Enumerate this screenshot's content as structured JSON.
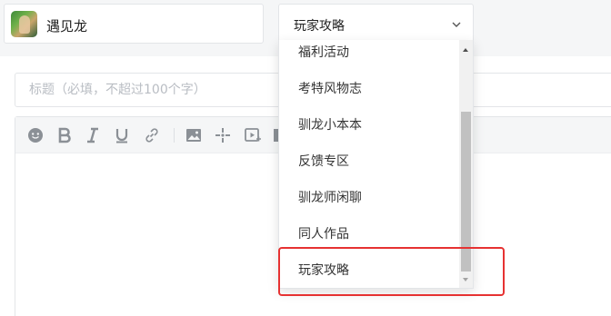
{
  "game_selector": {
    "name": "遇见龙"
  },
  "category_selector": {
    "value": "玩家攻略"
  },
  "title_field": {
    "placeholder": "标题（必填，不超过100个字）",
    "value": ""
  },
  "toolbar": {
    "buttons": [
      "emoji-icon",
      "bold-icon",
      "italic-icon",
      "underline-icon",
      "link-icon",
      "image-icon",
      "move-icon",
      "video-icon",
      "table-icon"
    ]
  },
  "dropdown": {
    "options": [
      "福利活动",
      "考特风物志",
      "驯龙小本本",
      "反馈专区",
      "驯龙师闲聊",
      "同人作品",
      "玩家攻略"
    ],
    "highlighted": "玩家攻略"
  },
  "colors": {
    "highlight_border": "#e63232",
    "icon_gray": "#8b9096"
  }
}
